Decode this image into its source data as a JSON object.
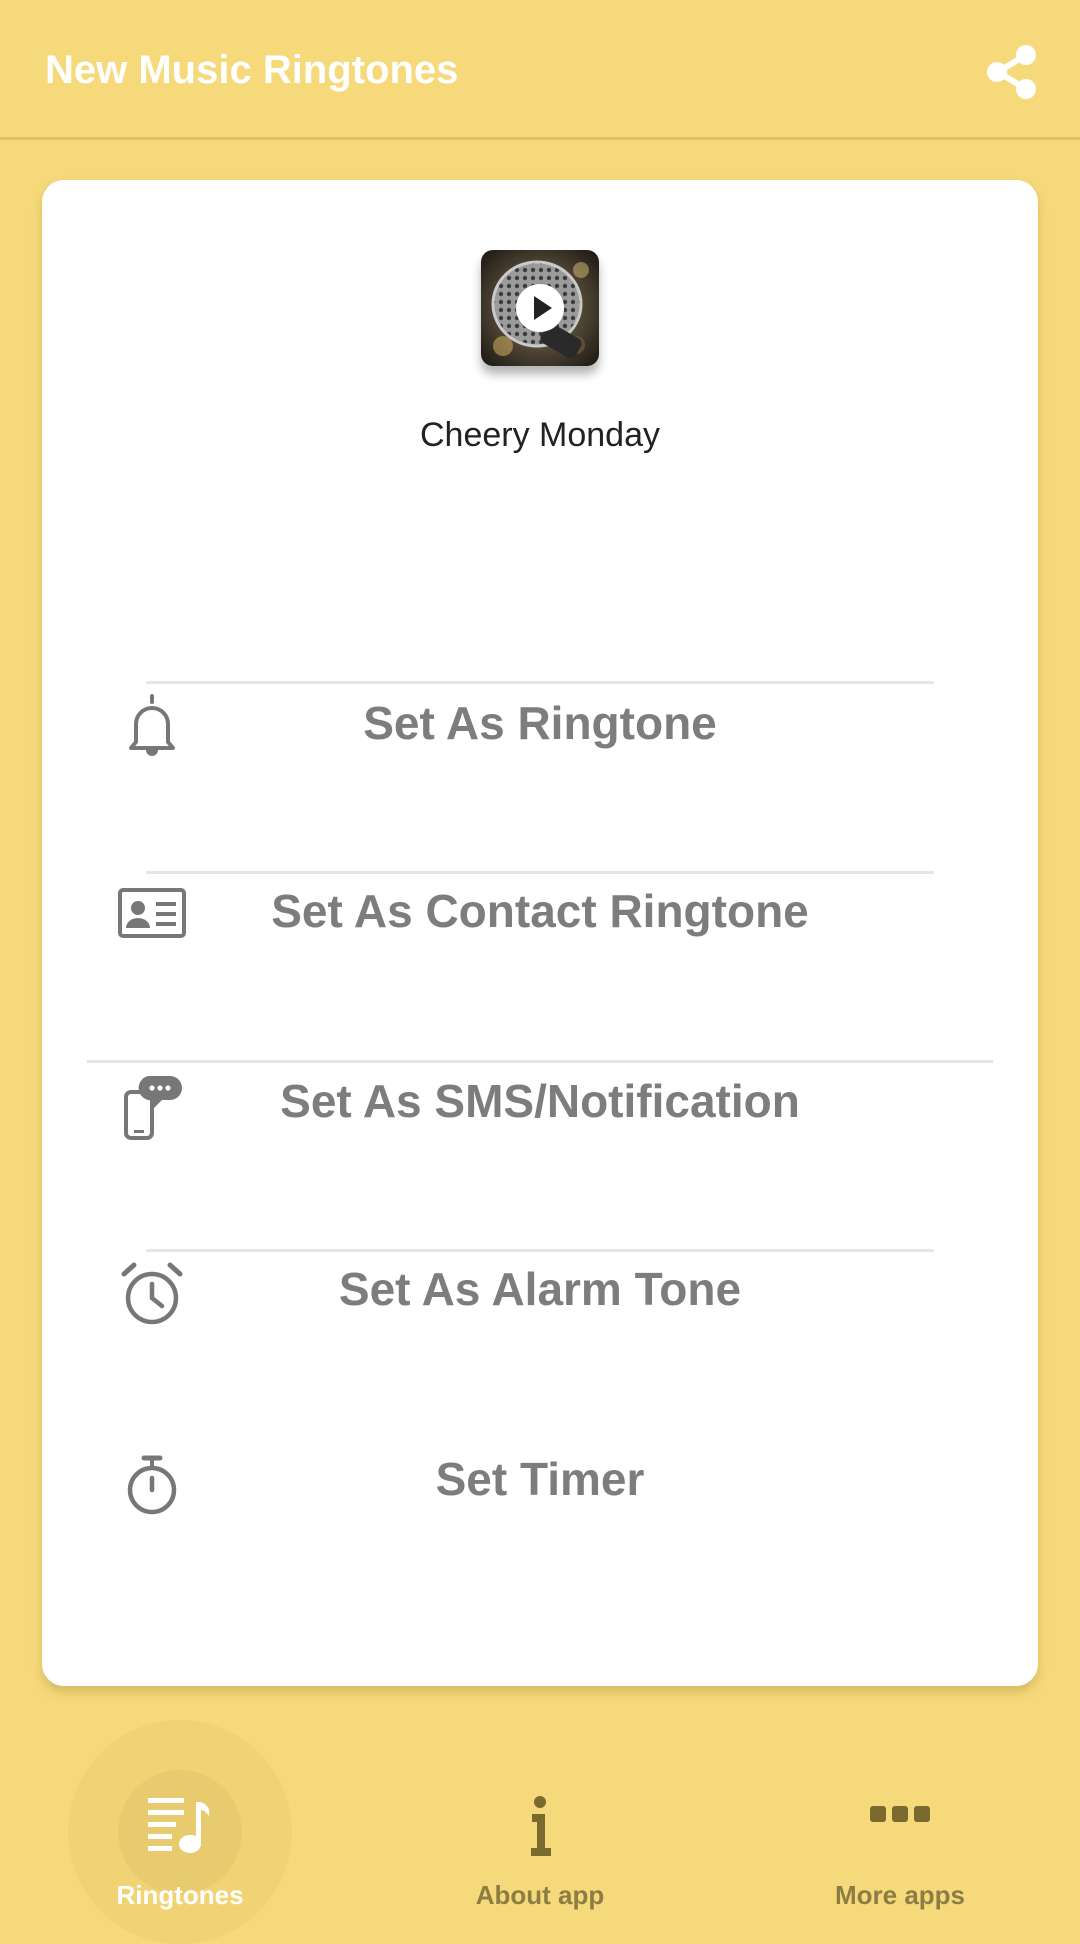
{
  "appbar": {
    "title": "New Music Ringtones",
    "share_icon": "share-icon"
  },
  "track": {
    "title": "Cheery Monday",
    "thumbnail": "microphone-thumbnail",
    "play_icon": "play-icon"
  },
  "actions": [
    {
      "label": "Set As Ringtone",
      "icon": "bell-icon"
    },
    {
      "label": "Set As Contact Ringtone",
      "icon": "contact-card-icon"
    },
    {
      "label": "Set As SMS/Notification",
      "icon": "phone-message-icon"
    },
    {
      "label": "Set As Alarm Tone",
      "icon": "alarm-clock-icon"
    },
    {
      "label": "Set Timer",
      "icon": "stopwatch-icon"
    }
  ],
  "nav": {
    "items": [
      {
        "label": "Ringtones",
        "icon": "music-list-icon",
        "active": true
      },
      {
        "label": "About app",
        "icon": "info-icon",
        "active": false
      },
      {
        "label": "More apps",
        "icon": "more-dots-icon",
        "active": false
      }
    ]
  },
  "colors": {
    "background": "#f6d97a",
    "card": "#ffffff",
    "action_text": "#7d7d7d",
    "nav_text": "#8c7d45"
  }
}
